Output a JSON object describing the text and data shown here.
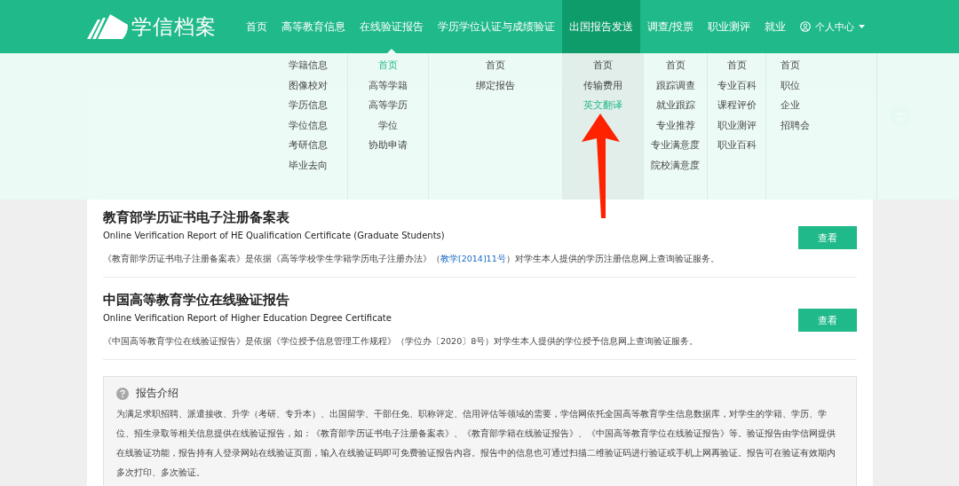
{
  "logo": {
    "text": "学信档案"
  },
  "nav": [
    {
      "label": "首页",
      "selected": false,
      "open": false
    },
    {
      "label": "高等教育信息",
      "selected": false,
      "open": false
    },
    {
      "label": "在线验证报告",
      "selected": false,
      "open": true
    },
    {
      "label": "学历学位认证与成绩验证",
      "selected": false,
      "open": false
    },
    {
      "label": "出国报告发送",
      "selected": true,
      "open": false
    },
    {
      "label": "调查/投票",
      "selected": false,
      "open": false
    },
    {
      "label": "职业测评",
      "selected": false,
      "open": false
    },
    {
      "label": "就业",
      "selected": false,
      "open": false
    }
  ],
  "user_menu": {
    "label": "个人中心"
  },
  "dropdown": [
    {
      "highlighted": false,
      "items": [
        {
          "label": "学籍信息",
          "selected": false
        },
        {
          "label": "图像校对",
          "selected": false
        },
        {
          "label": "学历信息",
          "selected": false
        },
        {
          "label": "学位信息",
          "selected": false
        },
        {
          "label": "考研信息",
          "selected": false
        },
        {
          "label": "毕业去向",
          "selected": false
        }
      ]
    },
    {
      "highlighted": false,
      "items": [
        {
          "label": "首页",
          "selected": true
        },
        {
          "label": "高等学籍",
          "selected": false
        },
        {
          "label": "高等学历",
          "selected": false
        },
        {
          "label": "学位",
          "selected": false
        },
        {
          "label": "协助申请",
          "selected": false
        }
      ]
    },
    {
      "highlighted": false,
      "items": [
        {
          "label": "首页",
          "selected": false
        },
        {
          "label": "绑定报告",
          "selected": false
        }
      ]
    },
    {
      "highlighted": true,
      "items": [
        {
          "label": "首页",
          "selected": false
        },
        {
          "label": "传输费用",
          "selected": false
        },
        {
          "label": "英文翻译",
          "selected": true
        }
      ]
    },
    {
      "highlighted": false,
      "items": [
        {
          "label": "首页",
          "selected": false
        },
        {
          "label": "跟踪调查",
          "selected": false
        },
        {
          "label": "就业跟踪",
          "selected": false
        },
        {
          "label": "专业推荐",
          "selected": false
        },
        {
          "label": "专业满意度",
          "selected": false
        },
        {
          "label": "院校满意度",
          "selected": false
        }
      ]
    },
    {
      "highlighted": false,
      "items": [
        {
          "label": "首页",
          "selected": false
        },
        {
          "label": "专业百科",
          "selected": false
        },
        {
          "label": "课程评价",
          "selected": false
        },
        {
          "label": "职业测评",
          "selected": false
        },
        {
          "label": "职业百科",
          "selected": false
        }
      ]
    },
    {
      "highlighted": false,
      "items": [
        {
          "label": "首页",
          "selected": false
        },
        {
          "label": "职位",
          "selected": false
        },
        {
          "label": "企业",
          "selected": false
        },
        {
          "label": "招聘会",
          "selected": false
        }
      ]
    }
  ],
  "reports": [
    {
      "title": "教育部学历证书电子注册备案表",
      "subtitle": "Online Verification Report of HE Qualification Certificate (Graduate Students)",
      "desc_before": "《教育部学历证书电子注册备案表》是依据《高等学校学生学籍学历电子注册办法》（",
      "link": "教学[2014]11号",
      "desc_after": "）对学生本人提供的学历注册信息网上查询验证服务。",
      "button": "查看"
    },
    {
      "title": "中国高等教育学位在线验证报告",
      "subtitle": "Online Verification Report of Higher Education Degree Certificate",
      "desc_before": "《中国高等教育学位在线验证报告》是依据《学位授予信息管理工作规程》（学位办〔2020〕8号）对学生本人提供的学位授予信息网上查询验证服务。",
      "button": "查看"
    }
  ],
  "intro": {
    "title": "报告介绍",
    "text": "为满足求职招聘、派遣接收、升学（考研、专升本）、出国留学、干部任免、职称评定、信用评估等领域的需要，学信网依托全国高等教育学生信息数据库，对学生的学籍、学历、学位、招生录取等相关信息提供在线验证报告，如：《教育部学历证书电子注册备案表》、《教育部学籍在线验证报告》、《中国高等教育学位在线验证报告》等。验证报告由学信网提供在线验证功能，报告持有人登录网站在线验证页面，输入在线验证码即可免费验证报告内容。报告中的信息也可通过扫描二维验证码进行验证或手机上网再验证。报告可在验证有效期内多次打印、多次验证。"
  }
}
